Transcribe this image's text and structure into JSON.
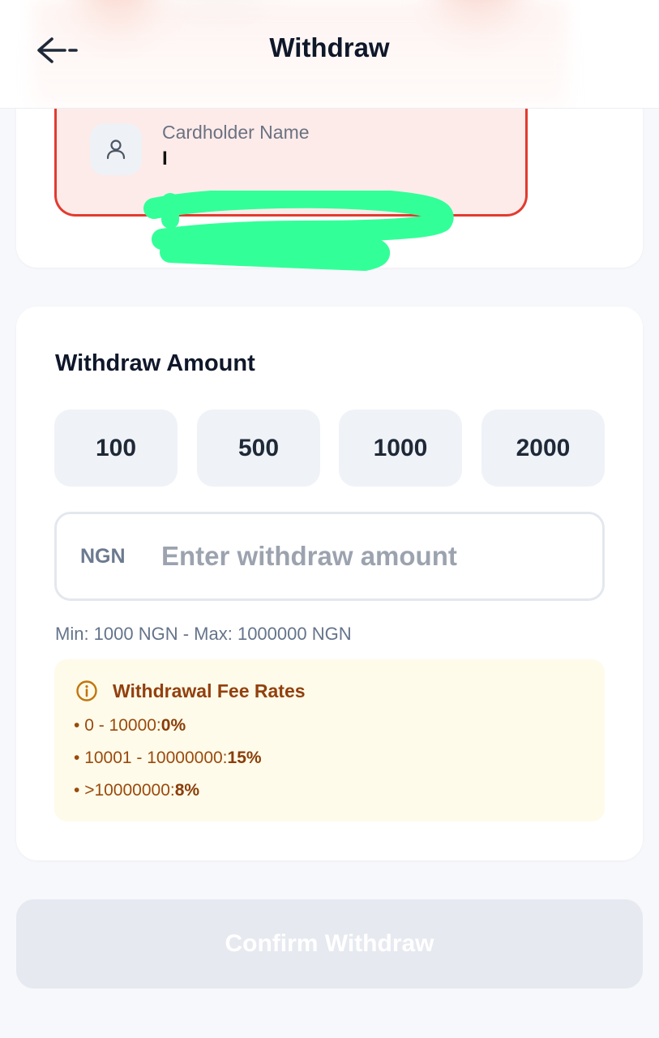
{
  "header": {
    "title": "Withdraw",
    "back_icon": "arrow-left-icon"
  },
  "card_info": {
    "holder_label": "Cardholder Name",
    "holder_value": "I",
    "holder_icon": "user-icon",
    "border_color": "#e23b2f",
    "bg_color": "#fdebea"
  },
  "amount_section": {
    "title": "Withdraw Amount",
    "presets": [
      "100",
      "500",
      "1000",
      "2000"
    ],
    "currency": "NGN",
    "placeholder": "Enter withdraw amount",
    "value": "",
    "limits": "Min: 1000 NGN - Max: 1000000 NGN"
  },
  "fees": {
    "icon": "info-icon",
    "title": "Withdrawal Fee Rates",
    "rates": [
      {
        "range": "0 - 10000:",
        "rate": "0%"
      },
      {
        "range": "10001 - 10000000:",
        "rate": "15%"
      },
      {
        "range": ">10000000:",
        "rate": "8%"
      }
    ],
    "accent": "#92400e",
    "bg_color": "#fefbea"
  },
  "confirm": {
    "label": "Confirm Withdraw",
    "disabled": true,
    "bg_color": "#e6e9f0"
  }
}
